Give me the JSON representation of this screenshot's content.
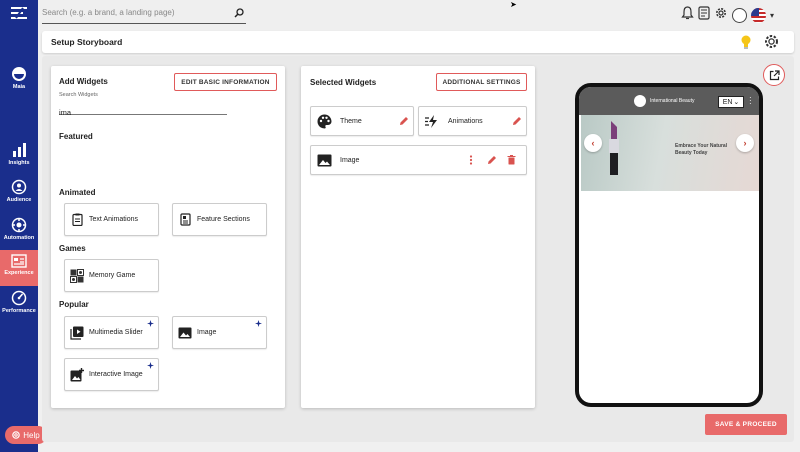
{
  "rail": {
    "items": [
      {
        "label": "Maia",
        "icon": "maia-icon"
      },
      {
        "label": "Insights",
        "icon": "bar-chart-icon"
      },
      {
        "label": "Audience",
        "icon": "audience-icon"
      },
      {
        "label": "Automation",
        "icon": "automation-icon"
      },
      {
        "label": "Experience",
        "icon": "experience-icon",
        "active": true
      },
      {
        "label": "Performance",
        "icon": "gauge-icon"
      }
    ],
    "help_label": "Help"
  },
  "topbar": {
    "search_placeholder": "Search (e.g. a brand, a landing page)"
  },
  "header": {
    "title": "Setup Storyboard"
  },
  "add_widgets": {
    "title": "Add Widgets",
    "edit_button": "EDIT BASIC INFORMATION",
    "search_label": "Search Widgets",
    "search_value": "ima",
    "sections": {
      "featured": "Featured",
      "animated": "Animated",
      "games": "Games",
      "popular": "Popular"
    },
    "animated_items": [
      "Text Animations",
      "Feature Sections"
    ],
    "games_items": [
      "Memory Game"
    ],
    "popular_items": [
      "Multimedia Slider",
      "Image",
      "Interactive Image"
    ]
  },
  "selected_widgets": {
    "title": "Selected Widgets",
    "settings_button": "ADDITIONAL SETTINGS",
    "items": [
      "Theme",
      "Animations",
      "Image"
    ]
  },
  "preview": {
    "brand": "International Beauty",
    "language": "EN",
    "tagline_1": "Embrace Your Natural",
    "tagline_2": "Beauty Today"
  },
  "save_button": "SAVE & PROCEED",
  "colors": {
    "rail": "#1a2e8c",
    "accent": "#e86a6a"
  }
}
